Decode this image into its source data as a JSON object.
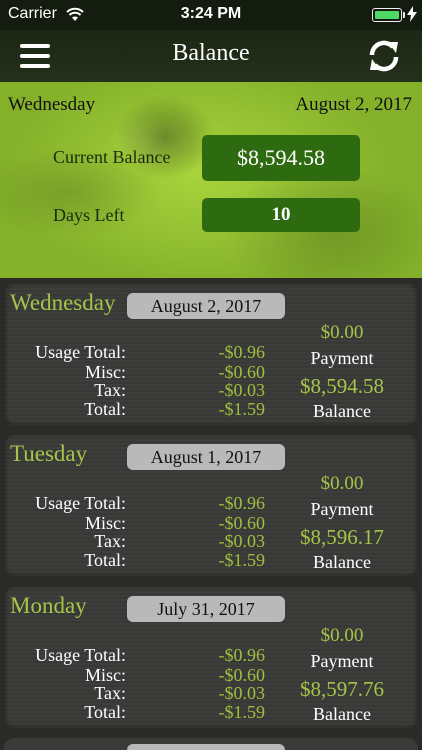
{
  "status_bar": {
    "carrier": "Carrier",
    "time": "3:24 PM",
    "battery_color": "#4cd964"
  },
  "nav": {
    "title": "Balance",
    "menu_icon": "hamburger-icon",
    "refresh_icon": "refresh-icon"
  },
  "summary": {
    "day": "Wednesday",
    "date": "August 2, 2017",
    "current_balance_label": "Current Balance",
    "current_balance": "$8,594.58",
    "days_left_label": "Days Left",
    "days_left": "10"
  },
  "labels": {
    "usage_total": "Usage Total:",
    "misc": "Misc:",
    "tax": "Tax:",
    "total": "Total:",
    "payment": "Payment",
    "balance": "Balance"
  },
  "days": [
    {
      "day": "Wednesday",
      "date": "August 2, 2017",
      "usage_total": "-$0.96",
      "misc": "-$0.60",
      "tax": "-$0.03",
      "total": "-$1.59",
      "payment": "$0.00",
      "balance": "$8,594.58"
    },
    {
      "day": "Tuesday",
      "date": "August 1, 2017",
      "usage_total": "-$0.96",
      "misc": "-$0.60",
      "tax": "-$0.03",
      "total": "-$1.59",
      "payment": "$0.00",
      "balance": "$8,596.17"
    },
    {
      "day": "Monday",
      "date": "July 31, 2017",
      "usage_total": "-$0.96",
      "misc": "-$0.60",
      "tax": "-$0.03",
      "total": "-$1.59",
      "payment": "$0.00",
      "balance": "$8,597.76"
    }
  ],
  "colors": {
    "accent_green": "#a6c44a",
    "button_green": "#2e6b10",
    "card_bg": "#3a3b38"
  }
}
